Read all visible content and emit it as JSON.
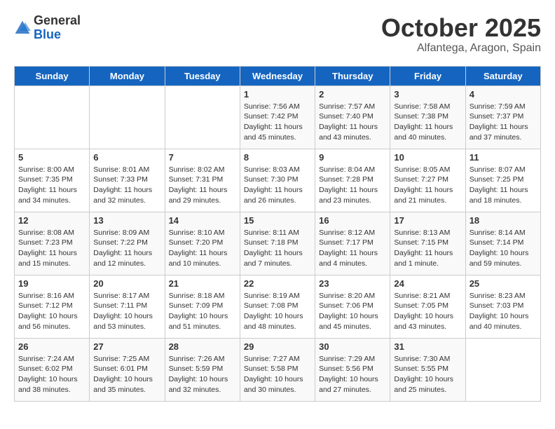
{
  "header": {
    "logo_general": "General",
    "logo_blue": "Blue",
    "month_title": "October 2025",
    "location": "Alfantega, Aragon, Spain"
  },
  "weekdays": [
    "Sunday",
    "Monday",
    "Tuesday",
    "Wednesday",
    "Thursday",
    "Friday",
    "Saturday"
  ],
  "weeks": [
    [
      {
        "day": "",
        "sunrise": "",
        "sunset": "",
        "daylight": ""
      },
      {
        "day": "",
        "sunrise": "",
        "sunset": "",
        "daylight": ""
      },
      {
        "day": "",
        "sunrise": "",
        "sunset": "",
        "daylight": ""
      },
      {
        "day": "1",
        "sunrise": "Sunrise: 7:56 AM",
        "sunset": "Sunset: 7:42 PM",
        "daylight": "Daylight: 11 hours and 45 minutes."
      },
      {
        "day": "2",
        "sunrise": "Sunrise: 7:57 AM",
        "sunset": "Sunset: 7:40 PM",
        "daylight": "Daylight: 11 hours and 43 minutes."
      },
      {
        "day": "3",
        "sunrise": "Sunrise: 7:58 AM",
        "sunset": "Sunset: 7:38 PM",
        "daylight": "Daylight: 11 hours and 40 minutes."
      },
      {
        "day": "4",
        "sunrise": "Sunrise: 7:59 AM",
        "sunset": "Sunset: 7:37 PM",
        "daylight": "Daylight: 11 hours and 37 minutes."
      }
    ],
    [
      {
        "day": "5",
        "sunrise": "Sunrise: 8:00 AM",
        "sunset": "Sunset: 7:35 PM",
        "daylight": "Daylight: 11 hours and 34 minutes."
      },
      {
        "day": "6",
        "sunrise": "Sunrise: 8:01 AM",
        "sunset": "Sunset: 7:33 PM",
        "daylight": "Daylight: 11 hours and 32 minutes."
      },
      {
        "day": "7",
        "sunrise": "Sunrise: 8:02 AM",
        "sunset": "Sunset: 7:31 PM",
        "daylight": "Daylight: 11 hours and 29 minutes."
      },
      {
        "day": "8",
        "sunrise": "Sunrise: 8:03 AM",
        "sunset": "Sunset: 7:30 PM",
        "daylight": "Daylight: 11 hours and 26 minutes."
      },
      {
        "day": "9",
        "sunrise": "Sunrise: 8:04 AM",
        "sunset": "Sunset: 7:28 PM",
        "daylight": "Daylight: 11 hours and 23 minutes."
      },
      {
        "day": "10",
        "sunrise": "Sunrise: 8:05 AM",
        "sunset": "Sunset: 7:27 PM",
        "daylight": "Daylight: 11 hours and 21 minutes."
      },
      {
        "day": "11",
        "sunrise": "Sunrise: 8:07 AM",
        "sunset": "Sunset: 7:25 PM",
        "daylight": "Daylight: 11 hours and 18 minutes."
      }
    ],
    [
      {
        "day": "12",
        "sunrise": "Sunrise: 8:08 AM",
        "sunset": "Sunset: 7:23 PM",
        "daylight": "Daylight: 11 hours and 15 minutes."
      },
      {
        "day": "13",
        "sunrise": "Sunrise: 8:09 AM",
        "sunset": "Sunset: 7:22 PM",
        "daylight": "Daylight: 11 hours and 12 minutes."
      },
      {
        "day": "14",
        "sunrise": "Sunrise: 8:10 AM",
        "sunset": "Sunset: 7:20 PM",
        "daylight": "Daylight: 11 hours and 10 minutes."
      },
      {
        "day": "15",
        "sunrise": "Sunrise: 8:11 AM",
        "sunset": "Sunset: 7:18 PM",
        "daylight": "Daylight: 11 hours and 7 minutes."
      },
      {
        "day": "16",
        "sunrise": "Sunrise: 8:12 AM",
        "sunset": "Sunset: 7:17 PM",
        "daylight": "Daylight: 11 hours and 4 minutes."
      },
      {
        "day": "17",
        "sunrise": "Sunrise: 8:13 AM",
        "sunset": "Sunset: 7:15 PM",
        "daylight": "Daylight: 11 hours and 1 minute."
      },
      {
        "day": "18",
        "sunrise": "Sunrise: 8:14 AM",
        "sunset": "Sunset: 7:14 PM",
        "daylight": "Daylight: 10 hours and 59 minutes."
      }
    ],
    [
      {
        "day": "19",
        "sunrise": "Sunrise: 8:16 AM",
        "sunset": "Sunset: 7:12 PM",
        "daylight": "Daylight: 10 hours and 56 minutes."
      },
      {
        "day": "20",
        "sunrise": "Sunrise: 8:17 AM",
        "sunset": "Sunset: 7:11 PM",
        "daylight": "Daylight: 10 hours and 53 minutes."
      },
      {
        "day": "21",
        "sunrise": "Sunrise: 8:18 AM",
        "sunset": "Sunset: 7:09 PM",
        "daylight": "Daylight: 10 hours and 51 minutes."
      },
      {
        "day": "22",
        "sunrise": "Sunrise: 8:19 AM",
        "sunset": "Sunset: 7:08 PM",
        "daylight": "Daylight: 10 hours and 48 minutes."
      },
      {
        "day": "23",
        "sunrise": "Sunrise: 8:20 AM",
        "sunset": "Sunset: 7:06 PM",
        "daylight": "Daylight: 10 hours and 45 minutes."
      },
      {
        "day": "24",
        "sunrise": "Sunrise: 8:21 AM",
        "sunset": "Sunset: 7:05 PM",
        "daylight": "Daylight: 10 hours and 43 minutes."
      },
      {
        "day": "25",
        "sunrise": "Sunrise: 8:23 AM",
        "sunset": "Sunset: 7:03 PM",
        "daylight": "Daylight: 10 hours and 40 minutes."
      }
    ],
    [
      {
        "day": "26",
        "sunrise": "Sunrise: 7:24 AM",
        "sunset": "Sunset: 6:02 PM",
        "daylight": "Daylight: 10 hours and 38 minutes."
      },
      {
        "day": "27",
        "sunrise": "Sunrise: 7:25 AM",
        "sunset": "Sunset: 6:01 PM",
        "daylight": "Daylight: 10 hours and 35 minutes."
      },
      {
        "day": "28",
        "sunrise": "Sunrise: 7:26 AM",
        "sunset": "Sunset: 5:59 PM",
        "daylight": "Daylight: 10 hours and 32 minutes."
      },
      {
        "day": "29",
        "sunrise": "Sunrise: 7:27 AM",
        "sunset": "Sunset: 5:58 PM",
        "daylight": "Daylight: 10 hours and 30 minutes."
      },
      {
        "day": "30",
        "sunrise": "Sunrise: 7:29 AM",
        "sunset": "Sunset: 5:56 PM",
        "daylight": "Daylight: 10 hours and 27 minutes."
      },
      {
        "day": "31",
        "sunrise": "Sunrise: 7:30 AM",
        "sunset": "Sunset: 5:55 PM",
        "daylight": "Daylight: 10 hours and 25 minutes."
      },
      {
        "day": "",
        "sunrise": "",
        "sunset": "",
        "daylight": ""
      }
    ]
  ]
}
